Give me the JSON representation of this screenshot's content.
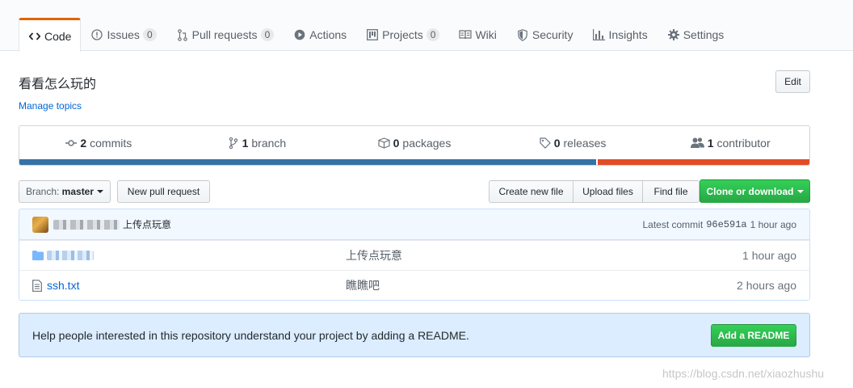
{
  "tabs": [
    {
      "label": "Code",
      "icon": "code-icon",
      "selected": true
    },
    {
      "label": "Issues",
      "icon": "issue-icon",
      "count": "0"
    },
    {
      "label": "Pull requests",
      "icon": "pull-request-icon",
      "count": "0"
    },
    {
      "label": "Actions",
      "icon": "play-icon"
    },
    {
      "label": "Projects",
      "icon": "project-icon",
      "count": "0"
    },
    {
      "label": "Wiki",
      "icon": "book-icon"
    },
    {
      "label": "Security",
      "icon": "shield-icon"
    },
    {
      "label": "Insights",
      "icon": "graph-icon"
    },
    {
      "label": "Settings",
      "icon": "gear-icon"
    }
  ],
  "repo": {
    "description": "看看怎么玩的",
    "manage_topics": "Manage topics",
    "edit_label": "Edit"
  },
  "summary": {
    "commits": {
      "count": "2",
      "label": "commits"
    },
    "branches": {
      "count": "1",
      "label": "branch"
    },
    "packages": {
      "count": "0",
      "label": "packages"
    },
    "releases": {
      "count": "0",
      "label": "releases"
    },
    "contributors": {
      "count": "1",
      "label": "contributor"
    }
  },
  "languages": [
    {
      "color": "#3572A5",
      "percent": 73
    },
    {
      "color": "#e34c26",
      "percent": 27
    }
  ],
  "file_nav": {
    "branch_prefix": "Branch:",
    "branch_name": "master",
    "new_pull_request": "New pull request",
    "create_new_file": "Create new file",
    "upload_files": "Upload files",
    "find_file": "Find file",
    "clone_or_download": "Clone or download"
  },
  "commit_tease": {
    "message": "上传点玩意",
    "latest_prefix": "Latest commit",
    "sha": "96e591a",
    "age": "1 hour ago"
  },
  "files": [
    {
      "type": "directory",
      "name": "",
      "message": "上传点玩意",
      "age": "1 hour ago"
    },
    {
      "type": "file",
      "name": "ssh.txt",
      "message": "瞧瞧吧",
      "age": "2 hours ago"
    }
  ],
  "readme_prompt": {
    "text": "Help people interested in this repository understand your project by adding a README.",
    "button": "Add a README"
  },
  "watermark": "https://blog.csdn.net/xiaozhushu"
}
